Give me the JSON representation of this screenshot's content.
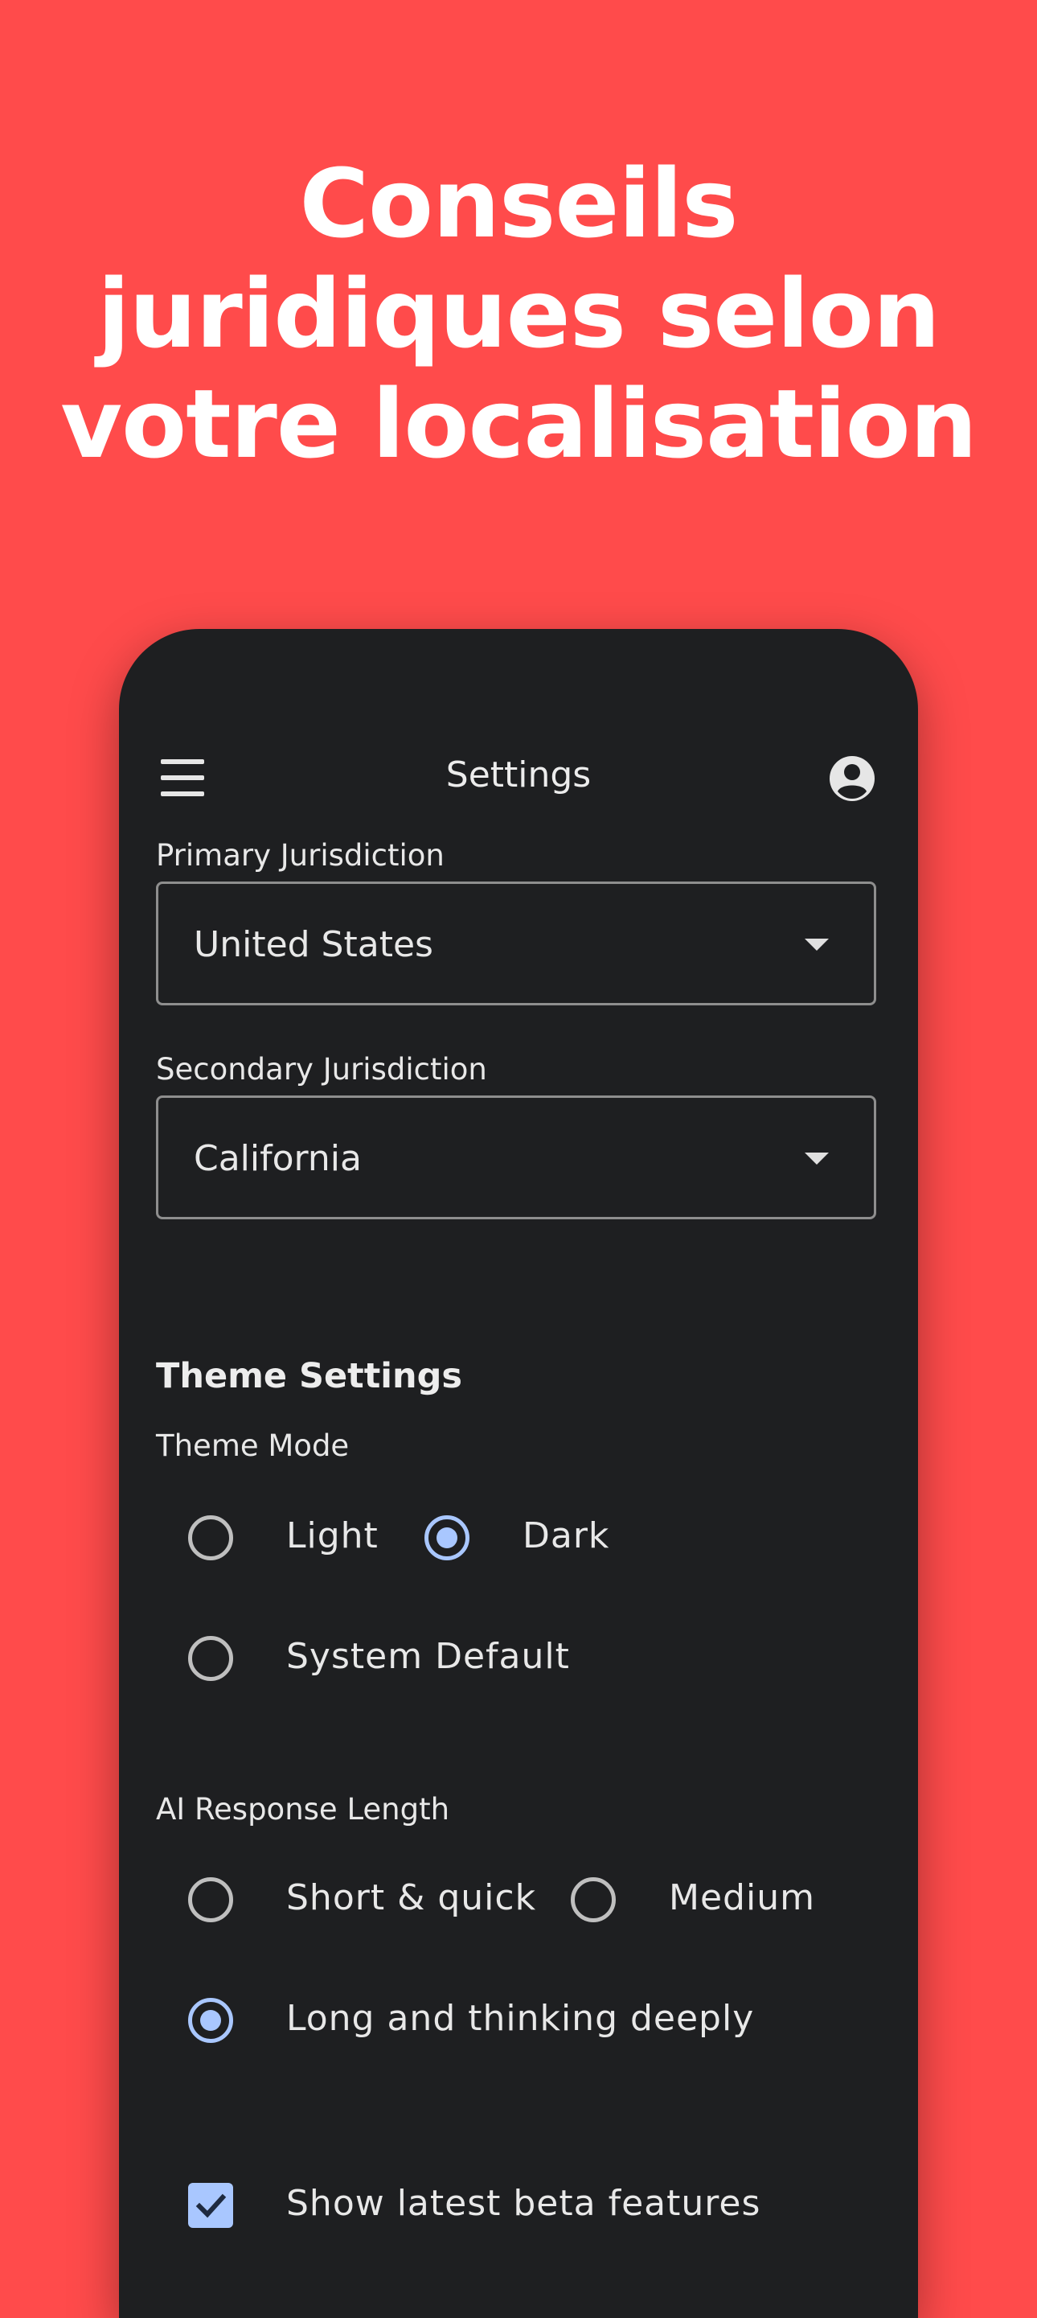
{
  "headline": {
    "line1": "Conseils",
    "line2": "juridiques selon",
    "line3": "votre localisation"
  },
  "appbar": {
    "title": "Settings",
    "menu_icon": "menu-icon",
    "account_icon": "account-circle-icon"
  },
  "jurisdiction": {
    "primary_label": "Primary Jurisdiction",
    "primary_value": "United States",
    "secondary_label": "Secondary Jurisdiction",
    "secondary_value": "California"
  },
  "theme": {
    "section_title": "Theme Settings",
    "mode_label": "Theme Mode",
    "options": [
      {
        "label": "Light",
        "selected": false
      },
      {
        "label": "Dark",
        "selected": true
      },
      {
        "label": "System Default",
        "selected": false
      }
    ]
  },
  "ai_response": {
    "label": "AI Response Length",
    "options": [
      {
        "label": "Short & quick",
        "selected": false
      },
      {
        "label": "Medium",
        "selected": false
      },
      {
        "label": "Long and thinking deeply",
        "selected": true
      }
    ]
  },
  "beta": {
    "label": "Show latest beta features",
    "checked": true
  },
  "colors": {
    "background": "#FF4B4B",
    "phone_surface": "#1E1F21",
    "accent": "#A9C7FF"
  }
}
